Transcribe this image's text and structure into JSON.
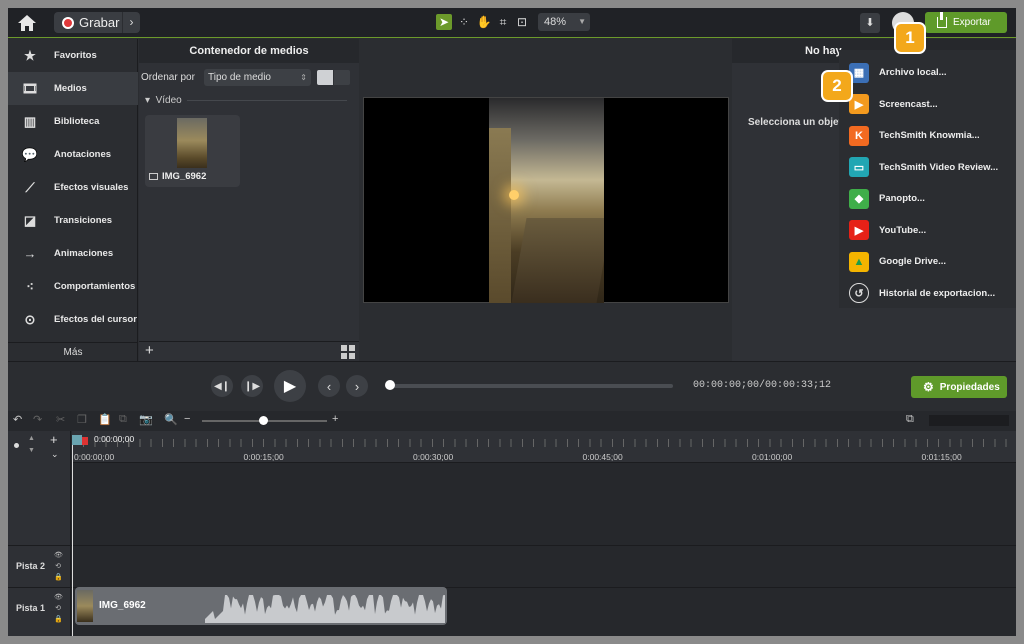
{
  "topbar": {
    "record_label": "Grabar",
    "zoom": "48%",
    "export_label": "Exportar"
  },
  "sidebar": {
    "items": [
      {
        "label": "Favoritos",
        "icon": "star-icon"
      },
      {
        "label": "Medios",
        "icon": "film-icon"
      },
      {
        "label": "Biblioteca",
        "icon": "library-icon"
      },
      {
        "label": "Anotaciones",
        "icon": "annotation-icon"
      },
      {
        "label": "Efectos visuales",
        "icon": "wand-icon"
      },
      {
        "label": "Transiciones",
        "icon": "transition-icon"
      },
      {
        "label": "Animaciones",
        "icon": "animation-icon"
      },
      {
        "label": "Comportamientos",
        "icon": "behavior-icon"
      },
      {
        "label": "Efectos del cursor",
        "icon": "cursor-effect-icon"
      }
    ],
    "active_index": 1,
    "more_label": "Más"
  },
  "media": {
    "title": "Contenedor de medios",
    "sort_label": "Ordenar por",
    "sort_value": "Tipo de medio",
    "section": "Vídeo",
    "clip_name": "IMG_6962"
  },
  "properties": {
    "title": "No hay",
    "message": "Selecciona un objet"
  },
  "export_menu": {
    "items": [
      {
        "label": "Archivo local...",
        "icon": "local-file-icon",
        "color": "#3b6fb6"
      },
      {
        "label": "Screencast...",
        "icon": "screencast-icon",
        "color": "#f39a1e"
      },
      {
        "label": "TechSmith Knowmia...",
        "icon": "knowmia-icon",
        "color": "#f26a21"
      },
      {
        "label": "TechSmith Video Review...",
        "icon": "video-review-icon",
        "color": "#22a6b3"
      },
      {
        "label": "Panopto...",
        "icon": "panopto-icon",
        "color": "#3fae49"
      },
      {
        "label": "YouTube...",
        "icon": "youtube-icon",
        "color": "#e62117"
      },
      {
        "label": "Google Drive...",
        "icon": "google-drive-icon",
        "color": "#f4b400"
      },
      {
        "label": "Historial de exportacion...",
        "icon": "history-icon",
        "color": "#2b2d31"
      }
    ]
  },
  "badges": {
    "one": "1",
    "two": "2"
  },
  "playback": {
    "timecode": "00:00:00;00/00:00:33;12",
    "properties_label": "Propiedades",
    "progress": 0
  },
  "timeline": {
    "playhead_time": "0:00:00;00",
    "ticks": [
      "0:00:00;00",
      "0:00:15;00",
      "0:00:30;00",
      "0:00:45;00",
      "0:01:00;00",
      "0:01:15;00"
    ],
    "tracks": [
      {
        "label": "Pista 2"
      },
      {
        "label": "Pista 1"
      }
    ],
    "clip_name": "IMG_6962"
  },
  "colors": {
    "accent_green": "#5f9a2a",
    "badge_orange": "#f3a81b"
  }
}
